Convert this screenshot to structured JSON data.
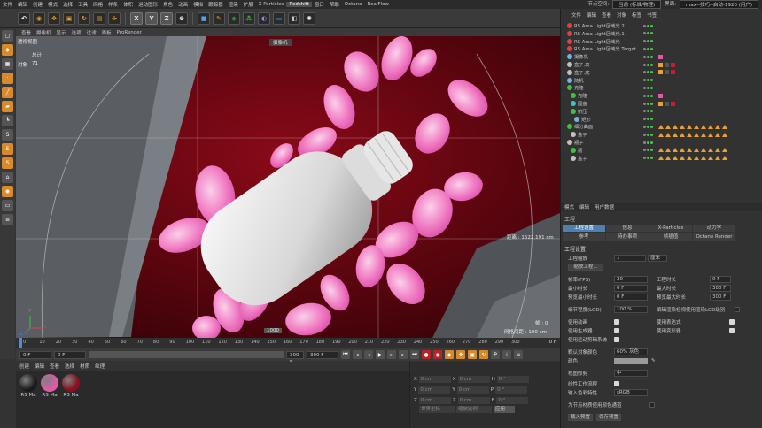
{
  "menu": {
    "items": [
      "文件",
      "编辑",
      "创建",
      "模式",
      "选择",
      "工具",
      "网格",
      "样条",
      "体积",
      "运动图形",
      "角色",
      "动画",
      "模拟",
      "跟踪器",
      "渲染",
      "扩展",
      "X-Particles",
      "Redshift",
      "窗口",
      "帮助",
      "Octane",
      "RealFlow"
    ],
    "active_item": "Redshift",
    "node_space_label": "节点空间:",
    "node_space_value": "当前 (标准/物理)",
    "layout_label": "界面:",
    "layout_value": "max--技巧--启动-1920 (用户)"
  },
  "viewport": {
    "menu": [
      "查看",
      "摄像机",
      "显示",
      "选项",
      "过滤",
      "面板",
      "ProRender"
    ],
    "view_name": "透视视图",
    "camera_label": "摄像机",
    "stats_label": "总计",
    "objects_label": "对象",
    "objects_count": "71",
    "distance": "距离 : 1522.191 cm",
    "hud_value": "1000",
    "frame_label": "帧 : 0",
    "grid_spacing": "网格间距 : 100 cm",
    "axis_y": "Y",
    "axis_x": "X",
    "axis_z": "Z"
  },
  "timeline": {
    "ticks": [
      "0",
      "10",
      "20",
      "30",
      "40",
      "50",
      "60",
      "70",
      "80",
      "90",
      "100",
      "110",
      "120",
      "130",
      "140",
      "150",
      "160",
      "170",
      "180",
      "190",
      "200",
      "210",
      "220",
      "230",
      "240",
      "250",
      "260",
      "270",
      "280",
      "290",
      "300"
    ],
    "end_frame": "0 F"
  },
  "transport": {
    "start": "0 F",
    "current": "0 F",
    "end": "300 F",
    "end2": "300 F"
  },
  "material_manager": {
    "menu": [
      "创建",
      "编辑",
      "查看",
      "选择",
      "材质",
      "纹理"
    ],
    "materials": [
      {
        "name": "RS Ma",
        "color": "#1a1a1a"
      },
      {
        "name": "RS Ma",
        "color": "#e05aa8"
      },
      {
        "name": "RS Ma",
        "color": "#8a0e1e"
      }
    ]
  },
  "coordinates": {
    "labels": [
      "X",
      "Y",
      "Z",
      "X",
      "Y",
      "Z",
      "H",
      "P",
      "B"
    ],
    "value_cm": "0 cm",
    "value_deg": "0 °",
    "mode_world": "世界坐标",
    "mode_scale": "缩放比例",
    "apply": "应用"
  },
  "object_manager": {
    "menu": [
      "文件",
      "编辑",
      "查看",
      "对象",
      "标签",
      "书签"
    ],
    "objects": [
      {
        "name": "RS Area Light区域光.2",
        "icon": "light-icon",
        "color": "#e04040",
        "indent": 1
      },
      {
        "name": "RS Area Light区域光.1",
        "icon": "light-icon",
        "color": "#e04040",
        "indent": 1
      },
      {
        "name": "RS Area Light区域光",
        "icon": "light-icon",
        "color": "#e04040",
        "indent": 1
      },
      {
        "name": "RS Area Light区域光.Target",
        "icon": "target-icon",
        "color": "#e04040",
        "indent": 1
      },
      {
        "name": "摄像机",
        "icon": "camera-icon",
        "color": "#7ab0e0",
        "indent": 1
      },
      {
        "name": "盒子.高",
        "icon": "null-icon",
        "color": "#c0c0c0",
        "indent": 1
      },
      {
        "name": "盒子.底",
        "icon": "null-icon",
        "color": "#c0c0c0",
        "indent": 1
      },
      {
        "name": "随机",
        "icon": "effector-icon",
        "color": "#7ab0e0",
        "indent": 1
      },
      {
        "name": "克隆",
        "icon": "cloner-icon",
        "color": "#40c040",
        "indent": 1
      },
      {
        "name": "克隆",
        "icon": "cloner-icon",
        "color": "#40c040",
        "indent": 2
      },
      {
        "name": "圆盘",
        "icon": "disc-icon",
        "color": "#40c0c0",
        "indent": 2
      },
      {
        "name": "挤压",
        "icon": "extrude-icon",
        "color": "#40c040",
        "indent": 2
      },
      {
        "name": "矩形",
        "icon": "rectangle-icon",
        "color": "#7ab0e0",
        "indent": 3
      },
      {
        "name": "细分曲面",
        "icon": "subdivision-icon",
        "color": "#40c040",
        "indent": 1
      },
      {
        "name": "盒子",
        "icon": "null-icon",
        "color": "#c0c0c0",
        "indent": 2
      },
      {
        "name": "瓶子",
        "icon": "null-icon",
        "color": "#c0c0c0",
        "indent": 1
      },
      {
        "name": "瓶",
        "icon": "lathe-icon",
        "color": "#40c040",
        "indent": 2
      },
      {
        "name": "盒子",
        "icon": "null-icon",
        "color": "#c0c0c0",
        "indent": 2
      }
    ]
  },
  "attribute_manager": {
    "menu": [
      "模式",
      "编辑",
      "用户数据"
    ],
    "title": "工程",
    "tabs_row1": [
      "工程设置",
      "信息",
      "X-Particles",
      "动力学"
    ],
    "tabs_row2": [
      "参考",
      "待办事项",
      "帧插值",
      "Octane Render"
    ],
    "active_tab": "工程设置",
    "section": "工程设置",
    "scale_label": "工程缩放",
    "scale_value": "1",
    "scale_unit": "厘米",
    "scale_button": "缩放工程...",
    "fps_label": "帧率(FPS)",
    "fps_value": "30",
    "project_time_label": "工程时长",
    "project_time_value": "0 F",
    "min_time_label": "最小时长",
    "min_time_value": "0 F",
    "max_time_label": "最大时长",
    "max_time_value": "300 F",
    "preview_min_label": "预览最小时长",
    "preview_min_value": "0 F",
    "preview_max_label": "预览最大时长",
    "preview_max_value": "300 F",
    "lod_label": "细节程度(LOD)",
    "lod_value": "100 %",
    "lod_render_label": "编辑渲染检视使用渲染LOD级别",
    "use_anim_label": "使用动画",
    "use_expr_label": "使用表达式",
    "use_gen_label": "使用生成器",
    "use_deform_label": "使用变形器",
    "use_motion_label": "使用运动剪辑系统",
    "default_color_label": "默认对象颜色",
    "default_color_value": "60% 灰色",
    "color_label": "颜色",
    "view_clip_label": "视图修剪",
    "view_clip_value": "中",
    "linear_label": "线性工作流程",
    "input_color_label": "输入色彩特性",
    "input_color_value": "sRGB",
    "node_color_label": "为节点材质使用颜色通道",
    "load_preset": "载入预置",
    "save_preset": "保存预置"
  }
}
